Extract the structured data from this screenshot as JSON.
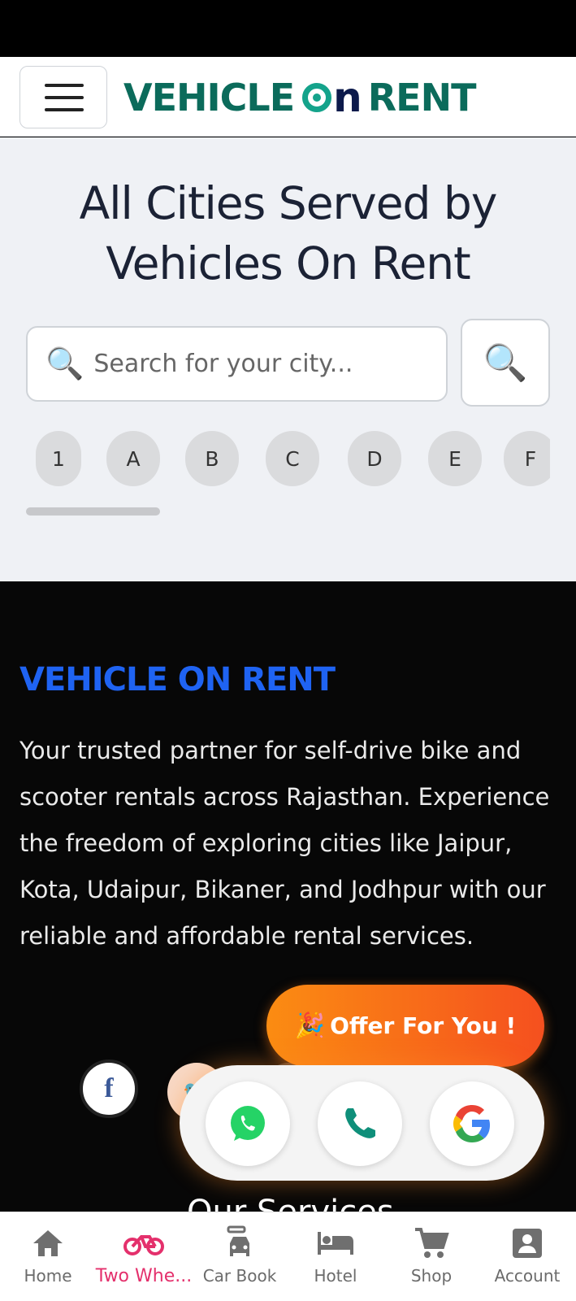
{
  "header": {
    "logo_part1": "VEHICLE",
    "logo_part2": "n",
    "logo_part3": "RENT",
    "menu_icon": "hamburger-icon"
  },
  "hero": {
    "title": "All Cities Served by Vehicles On Rent",
    "search_placeholder": "Search for your city...",
    "search_icon": "magnifier-icon",
    "letters": [
      "1",
      "A",
      "B",
      "C",
      "D",
      "E",
      "F"
    ]
  },
  "footer": {
    "brand": "VEHICLE ON RENT",
    "about": "Your trusted partner for self-drive bike and scooter rentals across Rajasthan. Experience the freedom of exploring cities like Jaipur, Kota, Udaipur, Bikaner, and Jodhpur with our reliable and affordable rental services.",
    "socials": [
      "facebook-icon",
      "twitter-icon",
      "linkedin-icon",
      "social-icon",
      "social-icon"
    ],
    "services_heading_partial": "Our Services"
  },
  "floating": {
    "offer_label": "Offer For You !",
    "offer_emoji": "🎉",
    "contacts": [
      "whatsapp-icon",
      "phone-icon",
      "google-icon"
    ]
  },
  "bottom_nav": {
    "items": [
      {
        "label": "Home",
        "icon": "home-icon"
      },
      {
        "label": "Two Whe...",
        "icon": "bike-icon"
      },
      {
        "label": "Car Book",
        "icon": "car-icon"
      },
      {
        "label": "Hotel",
        "icon": "bed-icon"
      },
      {
        "label": "Shop",
        "icon": "cart-icon"
      },
      {
        "label": "Account",
        "icon": "account-icon"
      }
    ],
    "active_index": 1,
    "active_color": "#e4306c"
  },
  "colors": {
    "brand_blue": "#1f63f2",
    "logo_green": "#0b6b5b",
    "offer_gradient_start": "#fb8c12",
    "offer_gradient_end": "#f5501f"
  }
}
